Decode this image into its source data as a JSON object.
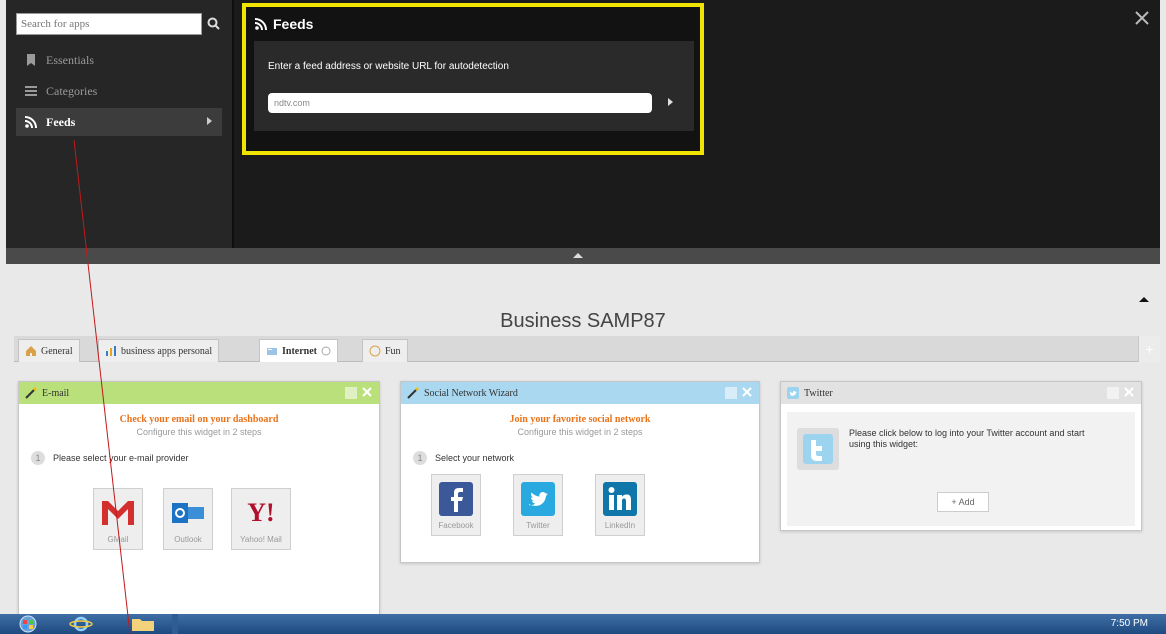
{
  "app_picker": {
    "search_placeholder": "Search for apps",
    "nav": [
      {
        "label": "Essentials",
        "icon": "bookmark-icon"
      },
      {
        "label": "Categories",
        "icon": "list-icon"
      },
      {
        "label": "Feeds",
        "icon": "rss-icon",
        "active": true
      }
    ]
  },
  "feeds_panel": {
    "title": "Feeds",
    "prompt": "Enter a feed address or website URL for autodetection",
    "input_value": "ndtv.com"
  },
  "dashboard": {
    "title": "Business SAMP87",
    "tabs": [
      {
        "label": "General",
        "icon": "home-icon"
      },
      {
        "label": "business apps personal",
        "icon": "bar-chart-icon"
      },
      {
        "label": "Internet",
        "icon": "globe-icon",
        "active": true
      },
      {
        "label": "Fun",
        "icon": "smiley-icon"
      }
    ]
  },
  "widgets": {
    "email": {
      "title": "E-mail",
      "headline": "Check your email on your dashboard",
      "sub": "Configure this widget in 2 steps",
      "step_num": "1",
      "step_text": "Please select your e-mail provider",
      "providers": [
        "GMail",
        "Outlook",
        "Yahoo! Mail"
      ]
    },
    "social": {
      "title": "Social Network Wizard",
      "headline": "Join your favorite social network",
      "sub": "Configure this widget in 2 steps",
      "step_num": "1",
      "step_text": "Select your network",
      "networks": [
        "Facebook",
        "Twitter",
        "LinkedIn"
      ]
    },
    "twitter": {
      "title": "Twitter",
      "message": "Please click below to log into your Twitter account and start using this widget:",
      "add_label": "+ Add"
    }
  },
  "taskbar": {
    "clock": "7:50 PM"
  },
  "colors": {
    "highlight": "#f0e400",
    "email_header": "#b9e07a",
    "social_header": "#a9d8f0",
    "twitter_header": "#e2e2e2",
    "accent_orange": "#e8731b"
  }
}
